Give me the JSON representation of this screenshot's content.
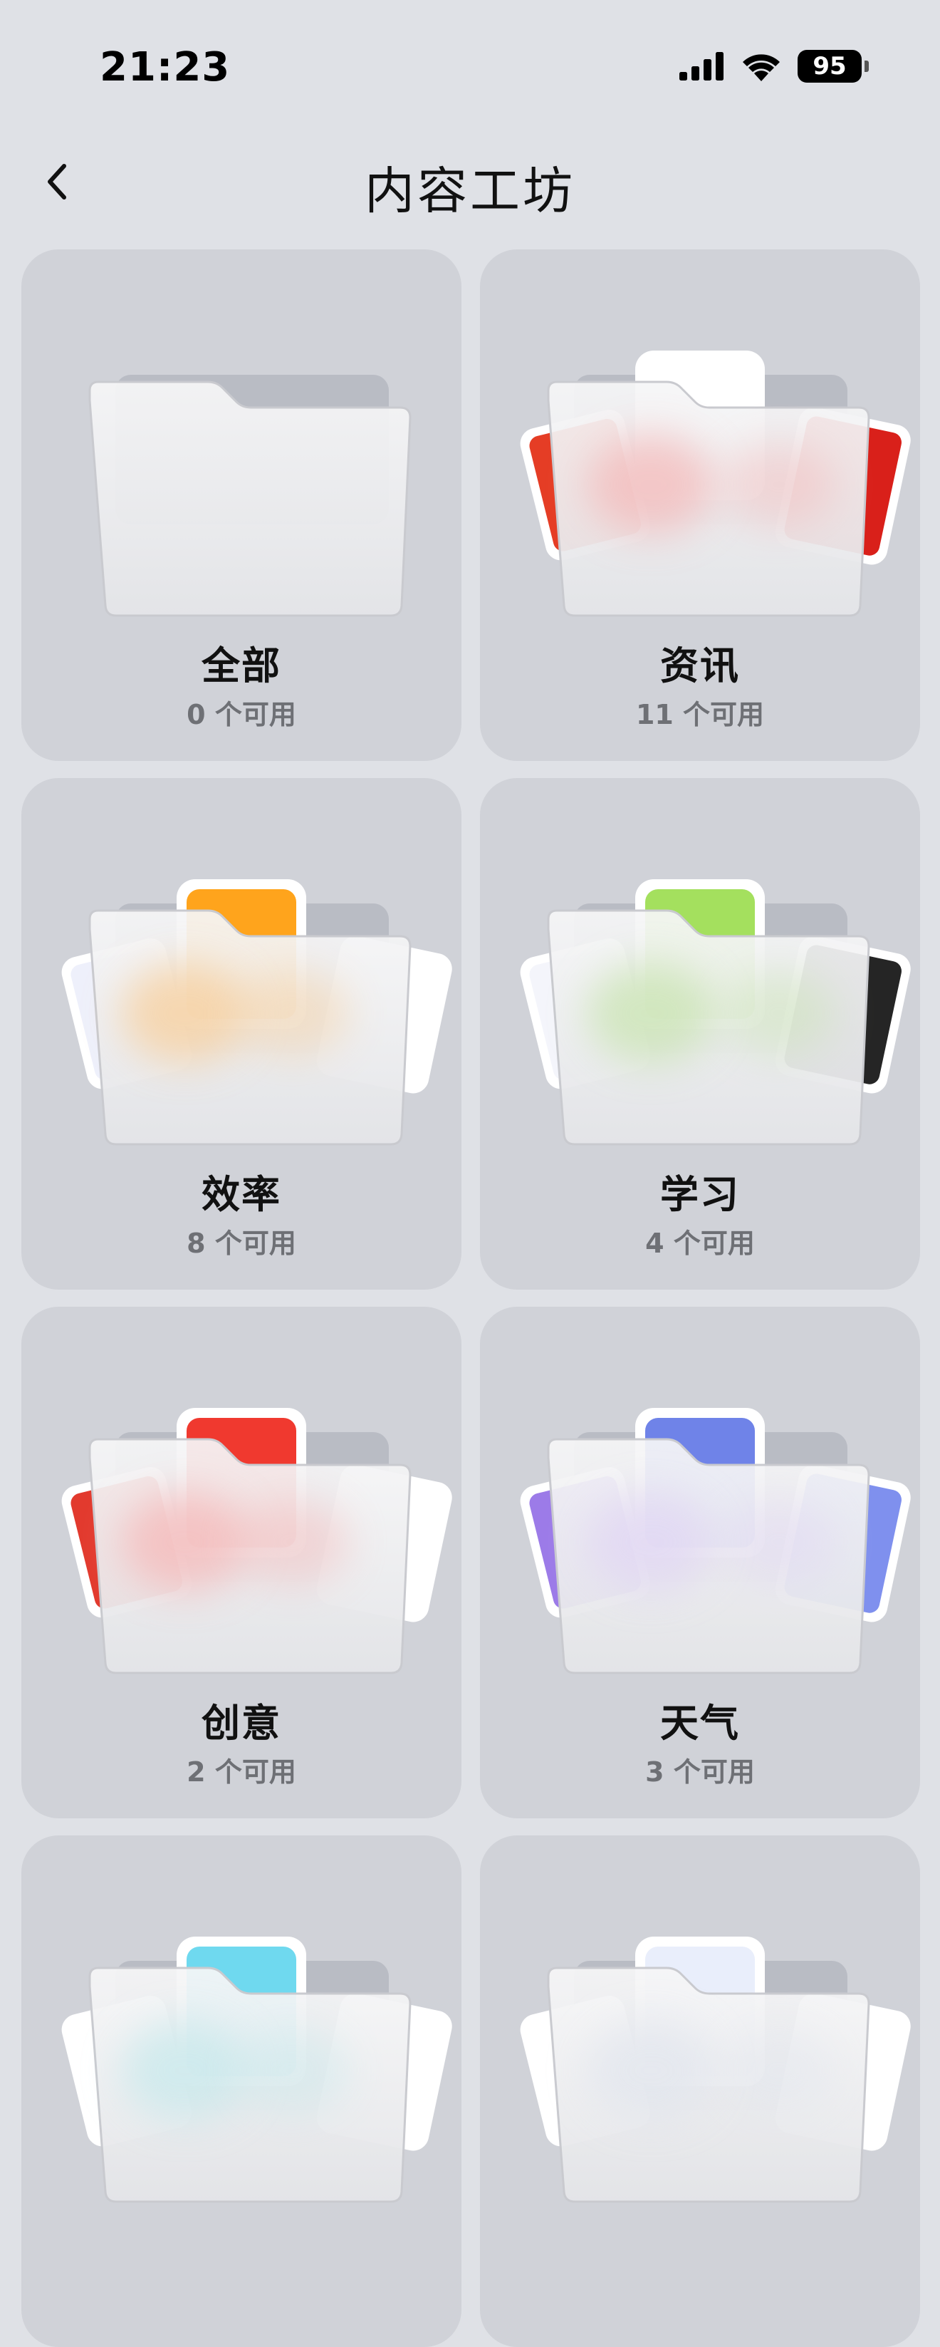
{
  "status_bar": {
    "time": "21:23",
    "battery": "95",
    "icons": [
      "cellular-signal-icon",
      "wifi-icon",
      "battery-icon"
    ]
  },
  "nav": {
    "title": "内容工坊",
    "back_icon": "chevron-left-icon"
  },
  "categories": [
    {
      "name": "全部",
      "count": "0 个可用",
      "accent": "#ffffff",
      "paper_left": null,
      "paper_top": null,
      "paper_right": null,
      "tint": null
    },
    {
      "name": "资讯",
      "count": "11 个可用",
      "accent": "#e8402a",
      "paper_left": "#e53d25",
      "paper_top": "#ffffff",
      "paper_right": "#d9201a",
      "tint": "#f4b9b9"
    },
    {
      "name": "效率",
      "count": "8 个可用",
      "accent": "#ffa31a",
      "paper_left": "#eef0fb",
      "paper_top": "#ffa41c",
      "paper_right": "#ffffff",
      "tint": "#f8cf9b"
    },
    {
      "name": "学习",
      "count": "4 个可用",
      "accent": "#a2e05a",
      "paper_left": "#f4f5fb",
      "paper_top": "#a4e05e",
      "paper_right": "#252525",
      "tint": "#c9e4b1"
    },
    {
      "name": "创意",
      "count": "2 个可用",
      "accent": "#f0392f",
      "paper_left": "#e23a2e",
      "paper_top": "#f0392f",
      "paper_right": "#ffffff",
      "tint": "#f6b8b8"
    },
    {
      "name": "天气",
      "count": "3 个可用",
      "accent": "#7b86e8",
      "paper_left": "#9c7be8",
      "paper_top": "#6f83e8",
      "paper_right": "#7f90ee",
      "tint": "#e1d6f4"
    },
    {
      "name": "",
      "count": "",
      "accent": "#6fd9ef",
      "paper_left": "#ffffff",
      "paper_top": "#6fd9ef",
      "paper_right": "#ffffff",
      "tint": "#c7e9ec"
    },
    {
      "name": "",
      "count": "",
      "accent": "#e9eefb",
      "paper_left": "#ffffff",
      "paper_top": "#e9eefb",
      "paper_right": "#ffffff",
      "tint": "#e2e6ee"
    }
  ]
}
